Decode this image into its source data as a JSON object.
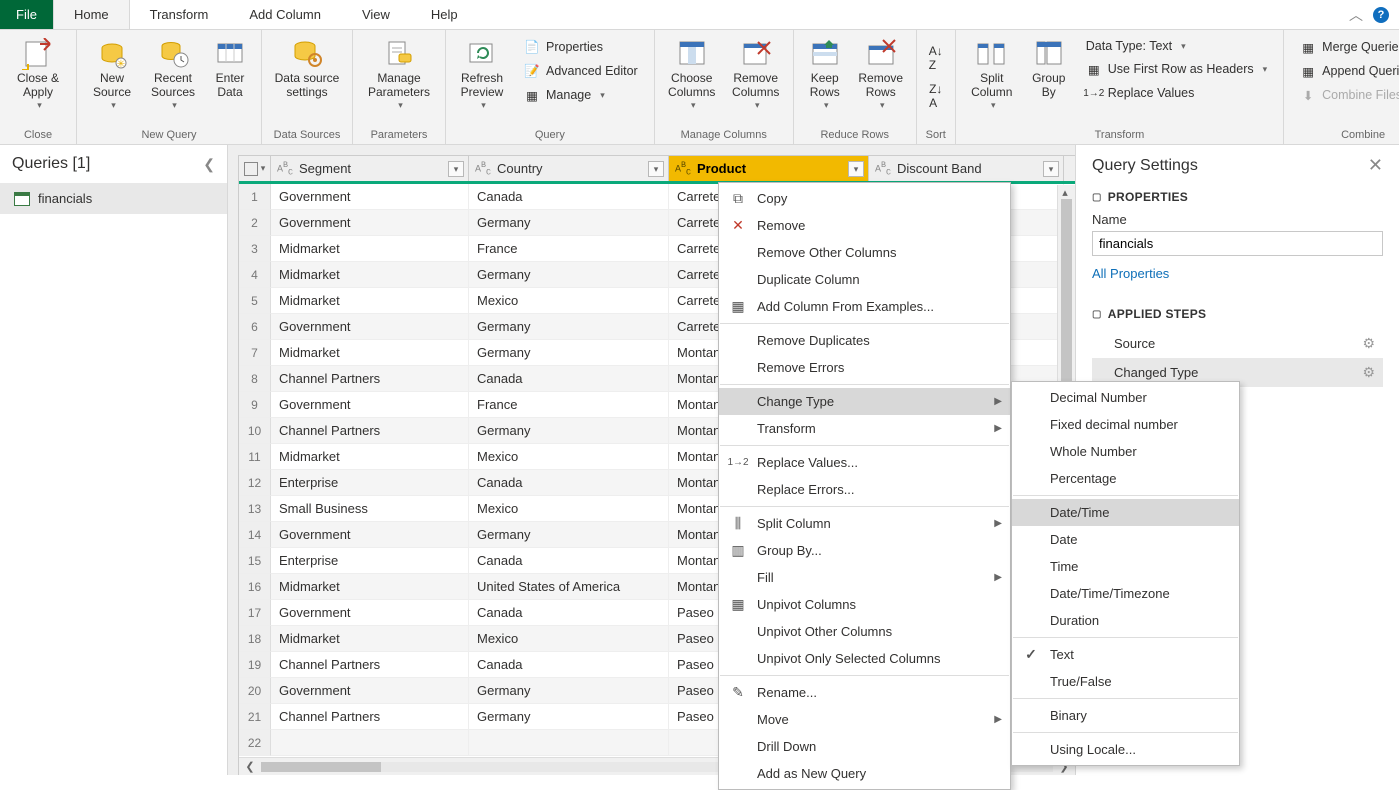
{
  "tabs": {
    "file": "File",
    "home": "Home",
    "transform": "Transform",
    "addcol": "Add Column",
    "view": "View",
    "help": "Help"
  },
  "ribbon": {
    "close": {
      "closeapply": "Close &\nApply",
      "group": "Close"
    },
    "newquery": {
      "newsource": "New\nSource",
      "recent": "Recent\nSources",
      "enter": "Enter\nData",
      "group": "New Query"
    },
    "datasources": {
      "settings": "Data source\nsettings",
      "group": "Data Sources"
    },
    "parameters": {
      "manage": "Manage\nParameters",
      "group": "Parameters"
    },
    "query": {
      "refresh": "Refresh\nPreview",
      "properties": "Properties",
      "adveditor": "Advanced Editor",
      "manage": "Manage",
      "group": "Query"
    },
    "managecols": {
      "choose": "Choose\nColumns",
      "remove": "Remove\nColumns",
      "group": "Manage Columns"
    },
    "reducerows": {
      "keep": "Keep\nRows",
      "remove": "Remove\nRows",
      "group": "Reduce Rows"
    },
    "sort": {
      "group": "Sort"
    },
    "transform": {
      "split": "Split\nColumn",
      "groupby": "Group\nBy",
      "datatype": "Data Type: Text",
      "firstrow": "Use First Row as Headers",
      "replace": "Replace Values",
      "group": "Transform"
    },
    "combine": {
      "merge": "Merge Queries",
      "append": "Append Queries",
      "combinefiles": "Combine Files",
      "group": "Combine"
    }
  },
  "queries": {
    "title": "Queries [1]",
    "item": "financials"
  },
  "columns": {
    "segment": "Segment",
    "country": "Country",
    "product": "Product",
    "discount": "Discount Band"
  },
  "rows": [
    {
      "n": "1",
      "seg": "Government",
      "cty": "Canada",
      "prd": "Carretera"
    },
    {
      "n": "2",
      "seg": "Government",
      "cty": "Germany",
      "prd": "Carretera"
    },
    {
      "n": "3",
      "seg": "Midmarket",
      "cty": "France",
      "prd": "Carretera"
    },
    {
      "n": "4",
      "seg": "Midmarket",
      "cty": "Germany",
      "prd": "Carretera"
    },
    {
      "n": "5",
      "seg": "Midmarket",
      "cty": "Mexico",
      "prd": "Carretera"
    },
    {
      "n": "6",
      "seg": "Government",
      "cty": "Germany",
      "prd": "Carretera"
    },
    {
      "n": "7",
      "seg": "Midmarket",
      "cty": "Germany",
      "prd": "Montana"
    },
    {
      "n": "8",
      "seg": "Channel Partners",
      "cty": "Canada",
      "prd": "Montana"
    },
    {
      "n": "9",
      "seg": "Government",
      "cty": "France",
      "prd": "Montana"
    },
    {
      "n": "10",
      "seg": "Channel Partners",
      "cty": "Germany",
      "prd": "Montana"
    },
    {
      "n": "11",
      "seg": "Midmarket",
      "cty": "Mexico",
      "prd": "Montana"
    },
    {
      "n": "12",
      "seg": "Enterprise",
      "cty": "Canada",
      "prd": "Montana"
    },
    {
      "n": "13",
      "seg": "Small Business",
      "cty": "Mexico",
      "prd": "Montana"
    },
    {
      "n": "14",
      "seg": "Government",
      "cty": "Germany",
      "prd": "Montana"
    },
    {
      "n": "15",
      "seg": "Enterprise",
      "cty": "Canada",
      "prd": "Montana"
    },
    {
      "n": "16",
      "seg": "Midmarket",
      "cty": "United States of America",
      "prd": "Montana"
    },
    {
      "n": "17",
      "seg": "Government",
      "cty": "Canada",
      "prd": "Paseo"
    },
    {
      "n": "18",
      "seg": "Midmarket",
      "cty": "Mexico",
      "prd": "Paseo"
    },
    {
      "n": "19",
      "seg": "Channel Partners",
      "cty": "Canada",
      "prd": "Paseo"
    },
    {
      "n": "20",
      "seg": "Government",
      "cty": "Germany",
      "prd": "Paseo"
    },
    {
      "n": "21",
      "seg": "Channel Partners",
      "cty": "Germany",
      "prd": "Paseo"
    },
    {
      "n": "22",
      "seg": "",
      "cty": "",
      "prd": ""
    }
  ],
  "settings": {
    "title": "Query Settings",
    "properties": "PROPERTIES",
    "namelabel": "Name",
    "name": "financials",
    "allprops": "All Properties",
    "applied": "APPLIED STEPS",
    "steps": {
      "source": "Source",
      "changedtype": "Changed Type"
    }
  },
  "ctx": {
    "copy": "Copy",
    "remove": "Remove",
    "removeother": "Remove Other Columns",
    "duplicate": "Duplicate Column",
    "addfromex": "Add Column From Examples...",
    "removedup": "Remove Duplicates",
    "removeerr": "Remove Errors",
    "changetype": "Change Type",
    "transform": "Transform",
    "replacevals": "Replace Values...",
    "replaceerr": "Replace Errors...",
    "splitcol": "Split Column",
    "groupby": "Group By...",
    "fill": "Fill",
    "unpivot": "Unpivot Columns",
    "unpivotother": "Unpivot Other Columns",
    "unpivotonly": "Unpivot Only Selected Columns",
    "rename": "Rename...",
    "move": "Move",
    "drill": "Drill Down",
    "addquery": "Add as New Query"
  },
  "typemenu": {
    "decimal": "Decimal Number",
    "fixed": "Fixed decimal number",
    "whole": "Whole Number",
    "percent": "Percentage",
    "datetime": "Date/Time",
    "date": "Date",
    "time": "Time",
    "dtz": "Date/Time/Timezone",
    "duration": "Duration",
    "text": "Text",
    "tf": "True/False",
    "binary": "Binary",
    "locale": "Using Locale..."
  }
}
